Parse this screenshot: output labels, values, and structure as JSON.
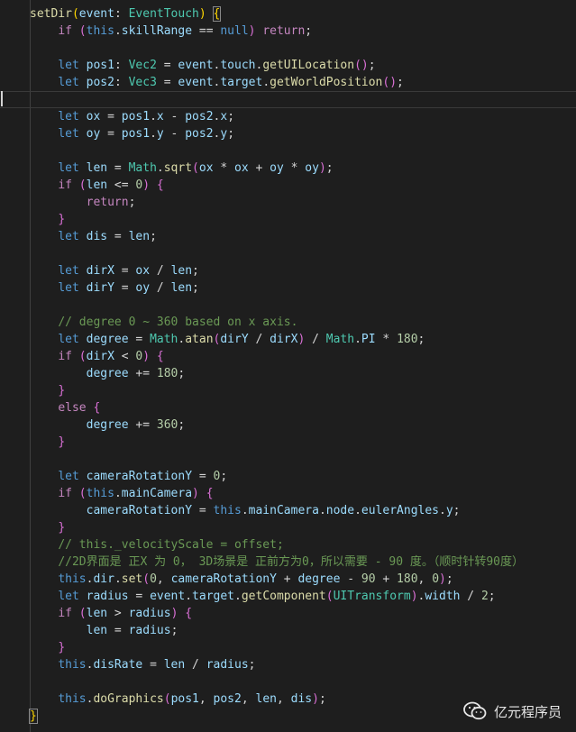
{
  "editor": {
    "language": "typescript",
    "theme_colors": {
      "background": "#1e1e1e",
      "keyword": "#569cd6",
      "control": "#c586c0",
      "function": "#dcdcaa",
      "variable": "#9cdcfe",
      "type": "#4ec9b0",
      "number": "#b5cea8",
      "comment": "#6a9955",
      "text": "#d4d4d4",
      "bracket": "#ffd700"
    },
    "lines": [
      [
        [
          "fn",
          "setDir"
        ],
        [
          "brace",
          "("
        ],
        [
          "var",
          "event"
        ],
        [
          "pun",
          ": "
        ],
        [
          "type",
          "EventTouch"
        ],
        [
          "brace",
          ")"
        ],
        [
          "pun",
          " "
        ],
        [
          "brace",
          "{"
        ]
      ],
      [
        [
          "pun",
          "    "
        ],
        [
          "ctrl",
          "if"
        ],
        [
          "pun",
          " "
        ],
        [
          "brace2",
          "("
        ],
        [
          "kw",
          "this"
        ],
        [
          "pun",
          "."
        ],
        [
          "var",
          "skillRange"
        ],
        [
          "pun",
          " == "
        ],
        [
          "kw",
          "null"
        ],
        [
          "brace2",
          ")"
        ],
        [
          "pun",
          " "
        ],
        [
          "ctrl",
          "return"
        ],
        [
          "pun",
          ";"
        ]
      ],
      [],
      [
        [
          "pun",
          "    "
        ],
        [
          "kw",
          "let"
        ],
        [
          "pun",
          " "
        ],
        [
          "var",
          "pos1"
        ],
        [
          "pun",
          ": "
        ],
        [
          "type",
          "Vec2"
        ],
        [
          "pun",
          " = "
        ],
        [
          "var",
          "event"
        ],
        [
          "pun",
          "."
        ],
        [
          "var",
          "touch"
        ],
        [
          "pun",
          "."
        ],
        [
          "fn",
          "getUILocation"
        ],
        [
          "brace2",
          "()"
        ],
        [
          "pun",
          ";"
        ]
      ],
      [
        [
          "pun",
          "    "
        ],
        [
          "kw",
          "let"
        ],
        [
          "pun",
          " "
        ],
        [
          "var",
          "pos2"
        ],
        [
          "pun",
          ": "
        ],
        [
          "type",
          "Vec3"
        ],
        [
          "pun",
          " = "
        ],
        [
          "var",
          "event"
        ],
        [
          "pun",
          "."
        ],
        [
          "var",
          "target"
        ],
        [
          "pun",
          "."
        ],
        [
          "fn",
          "getWorldPosition"
        ],
        [
          "brace2",
          "()"
        ],
        [
          "pun",
          ";"
        ]
      ],
      [],
      [
        [
          "pun",
          "    "
        ],
        [
          "kw",
          "let"
        ],
        [
          "pun",
          " "
        ],
        [
          "var",
          "ox"
        ],
        [
          "pun",
          " = "
        ],
        [
          "var",
          "pos1"
        ],
        [
          "pun",
          "."
        ],
        [
          "var",
          "x"
        ],
        [
          "pun",
          " - "
        ],
        [
          "var",
          "pos2"
        ],
        [
          "pun",
          "."
        ],
        [
          "var",
          "x"
        ],
        [
          "pun",
          ";"
        ]
      ],
      [
        [
          "pun",
          "    "
        ],
        [
          "kw",
          "let"
        ],
        [
          "pun",
          " "
        ],
        [
          "var",
          "oy"
        ],
        [
          "pun",
          " = "
        ],
        [
          "var",
          "pos1"
        ],
        [
          "pun",
          "."
        ],
        [
          "var",
          "y"
        ],
        [
          "pun",
          " - "
        ],
        [
          "var",
          "pos2"
        ],
        [
          "pun",
          "."
        ],
        [
          "var",
          "y"
        ],
        [
          "pun",
          ";"
        ]
      ],
      [],
      [
        [
          "pun",
          "    "
        ],
        [
          "kw",
          "let"
        ],
        [
          "pun",
          " "
        ],
        [
          "var",
          "len"
        ],
        [
          "pun",
          " = "
        ],
        [
          "type",
          "Math"
        ],
        [
          "pun",
          "."
        ],
        [
          "fn",
          "sqrt"
        ],
        [
          "brace2",
          "("
        ],
        [
          "var",
          "ox"
        ],
        [
          "pun",
          " * "
        ],
        [
          "var",
          "ox"
        ],
        [
          "pun",
          " + "
        ],
        [
          "var",
          "oy"
        ],
        [
          "pun",
          " * "
        ],
        [
          "var",
          "oy"
        ],
        [
          "brace2",
          ")"
        ],
        [
          "pun",
          ";"
        ]
      ],
      [
        [
          "pun",
          "    "
        ],
        [
          "ctrl",
          "if"
        ],
        [
          "pun",
          " "
        ],
        [
          "brace2",
          "("
        ],
        [
          "var",
          "len"
        ],
        [
          "pun",
          " <= "
        ],
        [
          "num",
          "0"
        ],
        [
          "brace2",
          ")"
        ],
        [
          "pun",
          " "
        ],
        [
          "brace2",
          "{"
        ]
      ],
      [
        [
          "pun",
          "        "
        ],
        [
          "ctrl",
          "return"
        ],
        [
          "pun",
          ";"
        ]
      ],
      [
        [
          "pun",
          "    "
        ],
        [
          "brace2",
          "}"
        ]
      ],
      [
        [
          "pun",
          "    "
        ],
        [
          "kw",
          "let"
        ],
        [
          "pun",
          " "
        ],
        [
          "var",
          "dis"
        ],
        [
          "pun",
          " = "
        ],
        [
          "var",
          "len"
        ],
        [
          "pun",
          ";"
        ]
      ],
      [],
      [
        [
          "pun",
          "    "
        ],
        [
          "kw",
          "let"
        ],
        [
          "pun",
          " "
        ],
        [
          "var",
          "dirX"
        ],
        [
          "pun",
          " = "
        ],
        [
          "var",
          "ox"
        ],
        [
          "pun",
          " / "
        ],
        [
          "var",
          "len"
        ],
        [
          "pun",
          ";"
        ]
      ],
      [
        [
          "pun",
          "    "
        ],
        [
          "kw",
          "let"
        ],
        [
          "pun",
          " "
        ],
        [
          "var",
          "dirY"
        ],
        [
          "pun",
          " = "
        ],
        [
          "var",
          "oy"
        ],
        [
          "pun",
          " / "
        ],
        [
          "var",
          "len"
        ],
        [
          "pun",
          ";"
        ]
      ],
      [],
      [
        [
          "pun",
          "    "
        ],
        [
          "cmt",
          "// degree 0 ~ 360 based on x axis."
        ]
      ],
      [
        [
          "pun",
          "    "
        ],
        [
          "kw",
          "let"
        ],
        [
          "pun",
          " "
        ],
        [
          "var",
          "degree"
        ],
        [
          "pun",
          " = "
        ],
        [
          "type",
          "Math"
        ],
        [
          "pun",
          "."
        ],
        [
          "fn",
          "atan"
        ],
        [
          "brace2",
          "("
        ],
        [
          "var",
          "dirY"
        ],
        [
          "pun",
          " / "
        ],
        [
          "var",
          "dirX"
        ],
        [
          "brace2",
          ")"
        ],
        [
          "pun",
          " / "
        ],
        [
          "type",
          "Math"
        ],
        [
          "pun",
          "."
        ],
        [
          "var",
          "PI"
        ],
        [
          "pun",
          " * "
        ],
        [
          "num",
          "180"
        ],
        [
          "pun",
          ";"
        ]
      ],
      [
        [
          "pun",
          "    "
        ],
        [
          "ctrl",
          "if"
        ],
        [
          "pun",
          " "
        ],
        [
          "brace2",
          "("
        ],
        [
          "var",
          "dirX"
        ],
        [
          "pun",
          " < "
        ],
        [
          "num",
          "0"
        ],
        [
          "brace2",
          ")"
        ],
        [
          "pun",
          " "
        ],
        [
          "brace2",
          "{"
        ]
      ],
      [
        [
          "pun",
          "        "
        ],
        [
          "var",
          "degree"
        ],
        [
          "pun",
          " += "
        ],
        [
          "num",
          "180"
        ],
        [
          "pun",
          ";"
        ]
      ],
      [
        [
          "pun",
          "    "
        ],
        [
          "brace2",
          "}"
        ]
      ],
      [
        [
          "pun",
          "    "
        ],
        [
          "ctrl",
          "else"
        ],
        [
          "pun",
          " "
        ],
        [
          "brace2",
          "{"
        ]
      ],
      [
        [
          "pun",
          "        "
        ],
        [
          "var",
          "degree"
        ],
        [
          "pun",
          " += "
        ],
        [
          "num",
          "360"
        ],
        [
          "pun",
          ";"
        ]
      ],
      [
        [
          "pun",
          "    "
        ],
        [
          "brace2",
          "}"
        ]
      ],
      [],
      [
        [
          "pun",
          "    "
        ],
        [
          "kw",
          "let"
        ],
        [
          "pun",
          " "
        ],
        [
          "var",
          "cameraRotationY"
        ],
        [
          "pun",
          " = "
        ],
        [
          "num",
          "0"
        ],
        [
          "pun",
          ";"
        ]
      ],
      [
        [
          "pun",
          "    "
        ],
        [
          "ctrl",
          "if"
        ],
        [
          "pun",
          " "
        ],
        [
          "brace2",
          "("
        ],
        [
          "kw",
          "this"
        ],
        [
          "pun",
          "."
        ],
        [
          "var",
          "mainCamera"
        ],
        [
          "brace2",
          ")"
        ],
        [
          "pun",
          " "
        ],
        [
          "brace2",
          "{"
        ]
      ],
      [
        [
          "pun",
          "        "
        ],
        [
          "var",
          "cameraRotationY"
        ],
        [
          "pun",
          " = "
        ],
        [
          "kw",
          "this"
        ],
        [
          "pun",
          "."
        ],
        [
          "var",
          "mainCamera"
        ],
        [
          "pun",
          "."
        ],
        [
          "var",
          "node"
        ],
        [
          "pun",
          "."
        ],
        [
          "var",
          "eulerAngles"
        ],
        [
          "pun",
          "."
        ],
        [
          "var",
          "y"
        ],
        [
          "pun",
          ";"
        ]
      ],
      [
        [
          "pun",
          "    "
        ],
        [
          "brace2",
          "}"
        ]
      ],
      [
        [
          "pun",
          "    "
        ],
        [
          "cmt",
          "// this._velocityScale = offset;"
        ]
      ],
      [
        [
          "pun",
          "    "
        ],
        [
          "cmt",
          "//2D界面是 正X 为 0， 3D场景是 正前方为0，所以需要 - 90 度。（顺时针转90度）"
        ]
      ],
      [
        [
          "pun",
          "    "
        ],
        [
          "kw",
          "this"
        ],
        [
          "pun",
          "."
        ],
        [
          "var",
          "dir"
        ],
        [
          "pun",
          "."
        ],
        [
          "fn",
          "set"
        ],
        [
          "brace2",
          "("
        ],
        [
          "num",
          "0"
        ],
        [
          "pun",
          ", "
        ],
        [
          "var",
          "cameraRotationY"
        ],
        [
          "pun",
          " + "
        ],
        [
          "var",
          "degree"
        ],
        [
          "pun",
          " - "
        ],
        [
          "num",
          "90"
        ],
        [
          "pun",
          " + "
        ],
        [
          "num",
          "180"
        ],
        [
          "pun",
          ", "
        ],
        [
          "num",
          "0"
        ],
        [
          "brace2",
          ")"
        ],
        [
          "pun",
          ";"
        ]
      ],
      [
        [
          "pun",
          "    "
        ],
        [
          "kw",
          "let"
        ],
        [
          "pun",
          " "
        ],
        [
          "var",
          "radius"
        ],
        [
          "pun",
          " = "
        ],
        [
          "var",
          "event"
        ],
        [
          "pun",
          "."
        ],
        [
          "var",
          "target"
        ],
        [
          "pun",
          "."
        ],
        [
          "fn",
          "getComponent"
        ],
        [
          "brace2",
          "("
        ],
        [
          "type",
          "UITransform"
        ],
        [
          "brace2",
          ")"
        ],
        [
          "pun",
          "."
        ],
        [
          "var",
          "width"
        ],
        [
          "pun",
          " / "
        ],
        [
          "num",
          "2"
        ],
        [
          "pun",
          ";"
        ]
      ],
      [
        [
          "pun",
          "    "
        ],
        [
          "ctrl",
          "if"
        ],
        [
          "pun",
          " "
        ],
        [
          "brace2",
          "("
        ],
        [
          "var",
          "len"
        ],
        [
          "pun",
          " > "
        ],
        [
          "var",
          "radius"
        ],
        [
          "brace2",
          ")"
        ],
        [
          "pun",
          " "
        ],
        [
          "brace2",
          "{"
        ]
      ],
      [
        [
          "pun",
          "        "
        ],
        [
          "var",
          "len"
        ],
        [
          "pun",
          " = "
        ],
        [
          "var",
          "radius"
        ],
        [
          "pun",
          ";"
        ]
      ],
      [
        [
          "pun",
          "    "
        ],
        [
          "brace2",
          "}"
        ]
      ],
      [
        [
          "pun",
          "    "
        ],
        [
          "kw",
          "this"
        ],
        [
          "pun",
          "."
        ],
        [
          "var",
          "disRate"
        ],
        [
          "pun",
          " = "
        ],
        [
          "var",
          "len"
        ],
        [
          "pun",
          " / "
        ],
        [
          "var",
          "radius"
        ],
        [
          "pun",
          ";"
        ]
      ],
      [],
      [
        [
          "pun",
          "    "
        ],
        [
          "kw",
          "this"
        ],
        [
          "pun",
          "."
        ],
        [
          "fn",
          "doGraphics"
        ],
        [
          "brace2",
          "("
        ],
        [
          "var",
          "pos1"
        ],
        [
          "pun",
          ", "
        ],
        [
          "var",
          "pos2"
        ],
        [
          "pun",
          ", "
        ],
        [
          "var",
          "len"
        ],
        [
          "pun",
          ", "
        ],
        [
          "var",
          "dis"
        ],
        [
          "brace2",
          ")"
        ],
        [
          "pun",
          ";"
        ]
      ],
      [
        [
          "brace",
          "}"
        ]
      ]
    ],
    "current_line": 5
  },
  "watermark": {
    "text": "亿元程序员",
    "icon": "wechat-official-account-icon"
  }
}
